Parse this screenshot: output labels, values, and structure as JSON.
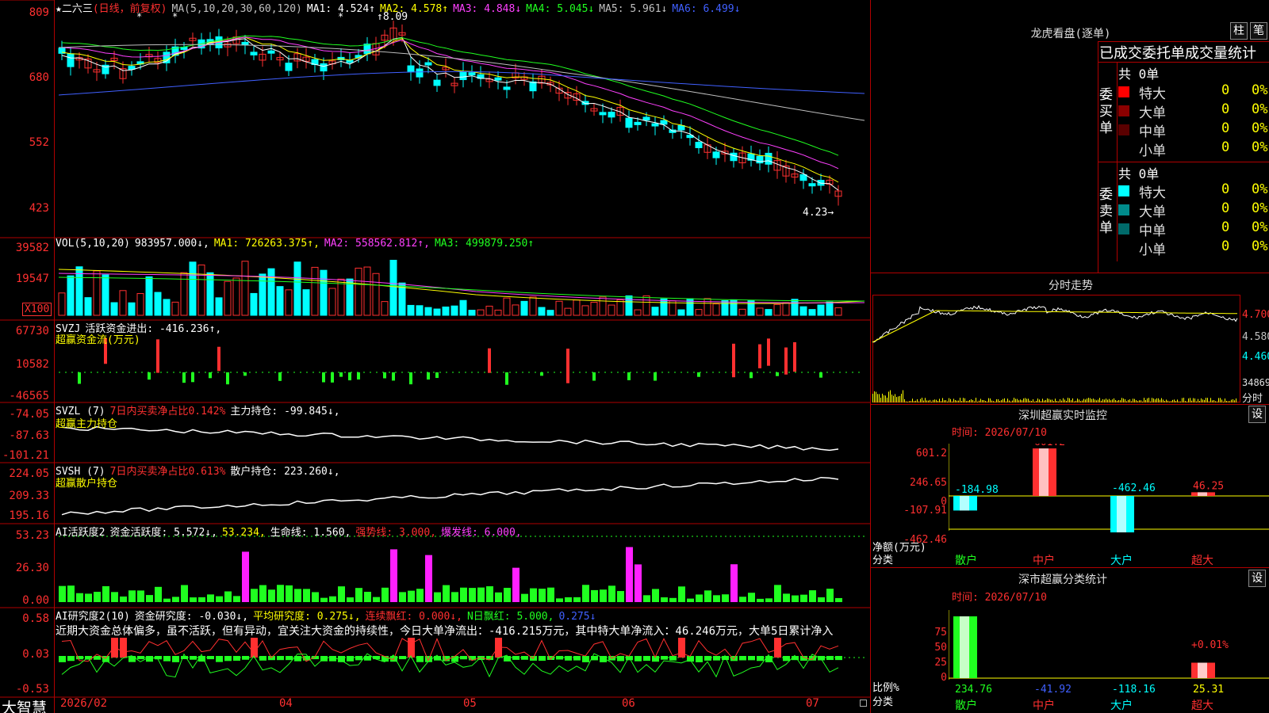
{
  "main_chart": {
    "title": "二六三",
    "period_label": "(日线，前复权)",
    "ma_label": "MA(5,10,20,30,60,120)",
    "ma_values": [
      {
        "label": "MA1:",
        "value": "4.524↑",
        "color": "#ffffff"
      },
      {
        "label": "MA2:",
        "value": "4.578↑",
        "color": "#ffff00"
      },
      {
        "label": "MA3:",
        "value": "4.848↓",
        "color": "#ff40ff"
      },
      {
        "label": "MA4:",
        "value": "5.045↓",
        "color": "#20ff20"
      },
      {
        "label": "MA5:",
        "value": "5.961↓",
        "color": "#c0c0c0"
      },
      {
        "label": "MA6:",
        "value": "6.499↓",
        "color": "#4060ff"
      }
    ],
    "y_ticks": [
      "809",
      "680",
      "552",
      "423"
    ],
    "high_label": "8.09",
    "low_label": "4.23"
  },
  "vol": {
    "header": "VOL(5,10,20)",
    "value": "983957.000↓,",
    "ma1": "MA1: 726263.375↑,",
    "ma2": "MA2: 558562.812↑,",
    "ma3": "MA3: 499879.250↑",
    "y_ticks": [
      "39582",
      "19547"
    ],
    "unit": "X100"
  },
  "svzj": {
    "header": "SVZJ",
    "item": "活跃资金进出: -416.236↑,",
    "title2": "超赢资金流(万元)",
    "y_ticks": [
      "67730",
      "10582",
      "-46565"
    ]
  },
  "svzl": {
    "header": "SVZL (7)",
    "item1": "7日内买卖净占比0.142%",
    "item2": "主力持仓: -99.845↓,",
    "title2": "超赢主力持仓",
    "y_ticks": [
      "-74.05",
      "-87.63",
      "-101.21"
    ]
  },
  "svsh": {
    "header": "SVSH (7)",
    "item1": "7日内买卖净占比0.613%",
    "item2": "散户持仓: 223.260↓,",
    "title2": "超赢散户持仓",
    "y_ticks": [
      "224.05",
      "209.33",
      "195.16"
    ]
  },
  "ai_act": {
    "header": "AI活跃度2",
    "item1": "资金活跃度: 5.572↓,",
    "item2": "53.234,",
    "item3": "生命线: 1.560,",
    "item4": "强势线: 3.000,",
    "item5": "爆发线: 6.000,",
    "y_ticks": [
      "53.23",
      "26.30",
      "0.00"
    ]
  },
  "ai_res": {
    "header": "AI研究度2(10)",
    "item1": "资金研究度: -0.030↓,",
    "item2": "平均研究度: 0.275↓,",
    "item3": "连续飘红: 0.000↓,",
    "item4": "N日飘红: 5.000,",
    "item5": "0.275↓",
    "comment": "近期大资金总体偏多，虽不活跃，但有异动，宜关注大资金的持续性，今日大单净流出：-416.215万元，其中特大单净流入：46.246万元，大单5日累计净入",
    "y_ticks": [
      "0.58",
      "0.03",
      "-0.53"
    ]
  },
  "footer": {
    "brand": "大智慧",
    "x_ticks": [
      "2026/02",
      "04",
      "05",
      "06",
      "07"
    ]
  },
  "longhu": {
    "title": "龙虎看盘(逐单)",
    "btn1": "柱",
    "btn2": "笔",
    "tabs": "已成交委托单成交量统计",
    "buy_label": "委买单",
    "sell_label": "委卖单",
    "buy_total": "共 0单",
    "sell_total": "共 0单",
    "buy_rows": [
      {
        "name": "特大",
        "v1": "0",
        "v2": "0%",
        "color": "#ff0000"
      },
      {
        "name": "大单",
        "v1": "0",
        "v2": "0%",
        "color": "#8b0000"
      },
      {
        "name": "中单",
        "v1": "0",
        "v2": "0%",
        "color": "#5a0000"
      },
      {
        "name": "小单",
        "v1": "0",
        "v2": "0%",
        "color": "#000000"
      }
    ],
    "sell_rows": [
      {
        "name": "特大",
        "v1": "0",
        "v2": "0%",
        "color": "#00ffff"
      },
      {
        "name": "大单",
        "v1": "0",
        "v2": "0%",
        "color": "#008b8b"
      },
      {
        "name": "中单",
        "v1": "0",
        "v2": "0%",
        "color": "#006a6a"
      },
      {
        "name": "小单",
        "v1": "0",
        "v2": "0%",
        "color": "#000000"
      }
    ]
  },
  "intraday": {
    "title": "分时走势",
    "price_ticks": [
      "4.700",
      "4.580",
      "4.460"
    ],
    "vol_tick": "34869",
    "vol_label": "分时"
  },
  "sz_monitor": {
    "title": "深圳超赢实时监控",
    "btn": "设",
    "time_label": "时间: 2026/07/10",
    "y_ticks": [
      "601.2",
      "246.65",
      "0",
      "-107.91",
      "-462.46"
    ],
    "y_unit": "净额(万元)",
    "cat_label": "分类",
    "categories": [
      "散户",
      "中户",
      "大户",
      "超大"
    ],
    "chart_data": {
      "type": "bar",
      "categories": [
        "散户",
        "中户",
        "大户",
        "超大"
      ],
      "values": [
        -184.98,
        601.2,
        -462.46,
        46.25
      ],
      "ylim": [
        -462.46,
        601.2
      ]
    },
    "value_labels": [
      "-184.98",
      "601.2",
      "-462.46",
      "46.25"
    ]
  },
  "sz_stat": {
    "title": "深市超赢分类统计",
    "btn": "设",
    "time_label": "时间: 2026/07/10",
    "y_ticks": [
      "75",
      "50",
      "25",
      "0"
    ],
    "y_unit": "比例%",
    "cat_label": "分类",
    "categories": [
      "散户",
      "中户",
      "大户",
      "超大"
    ],
    "bottom_values": [
      "234.76",
      "-41.92",
      "-118.16",
      "25.31"
    ],
    "pct_label": "+0.01%",
    "chart_data": {
      "type": "bar",
      "categories": [
        "散户",
        "中户",
        "大户",
        "超大"
      ],
      "values": [
        100,
        0,
        0,
        25
      ],
      "ylim": [
        0,
        100
      ]
    }
  }
}
